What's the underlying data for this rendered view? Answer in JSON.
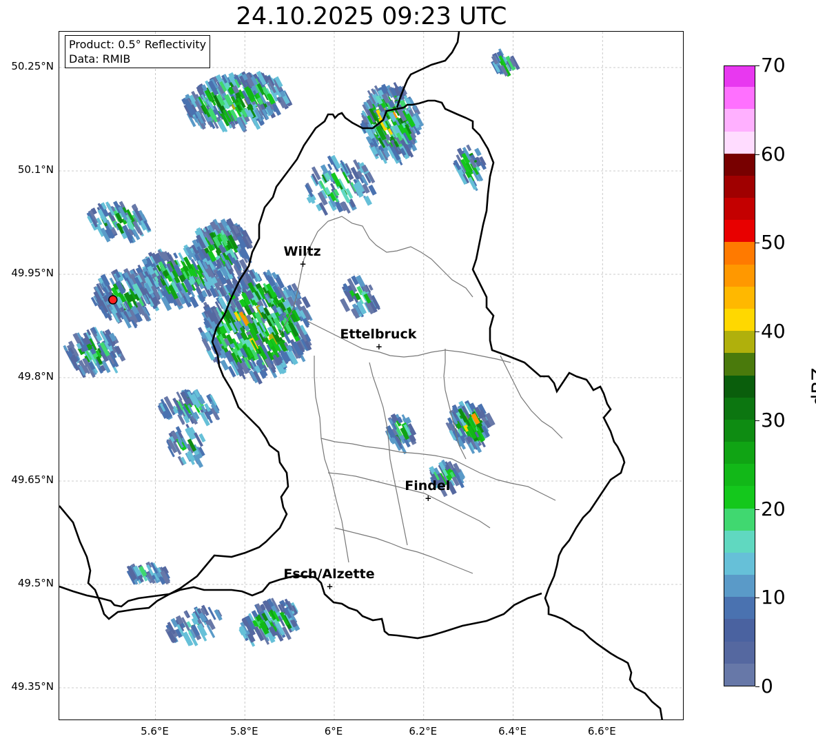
{
  "title": "24.10.2025 09:23 UTC",
  "info": {
    "line1": "Product: 0.5° Reflectivity",
    "line2": "Data: RMIB"
  },
  "lat_ticks": [
    "50.25°N",
    "50.1°N",
    "49.95°N",
    "49.8°N",
    "49.65°N",
    "49.5°N",
    "49.35°N"
  ],
  "lon_ticks": [
    "5.6°E",
    "5.8°E",
    "6°E",
    "6.2°E",
    "6.4°E",
    "6.6°E"
  ],
  "cities": [
    {
      "name": "Wiltz",
      "lon": 5.93,
      "lat": 49.965
    },
    {
      "name": "Ettelbruck",
      "lon": 6.1,
      "lat": 49.845
    },
    {
      "name": "Findel",
      "lon": 6.21,
      "lat": 49.625
    },
    {
      "name": "Esch/Alzette",
      "lon": 5.99,
      "lat": 49.497
    }
  ],
  "radar_site": {
    "lon": 5.505,
    "lat": 49.913
  },
  "colorbar": {
    "label": "dBZ",
    "ticks": [
      "0",
      "10",
      "20",
      "30",
      "40",
      "50",
      "60",
      "70"
    ],
    "min": 0,
    "max": 70,
    "step": 2.5,
    "colors": [
      "#6778a8",
      "#5568a0",
      "#4a62a0",
      "#4a72b0",
      "#5a9ac8",
      "#66c0d8",
      "#60d8c0",
      "#40d870",
      "#14c81c",
      "#12b818",
      "#10a414",
      "#0e8c12",
      "#0c7610",
      "#0a5e0c",
      "#4a7a0c",
      "#b0b00c",
      "#ffd800",
      "#ffb800",
      "#ff9800",
      "#ff7a00",
      "#e80000",
      "#c40000",
      "#a00000",
      "#780000",
      "#ffdcff",
      "#ffb0ff",
      "#ff70ff",
      "#e838f0"
    ]
  },
  "map_extent": {
    "lon_min": 5.385,
    "lon_max": 6.783,
    "lat_min": 49.302,
    "lat_max": 50.302
  }
}
